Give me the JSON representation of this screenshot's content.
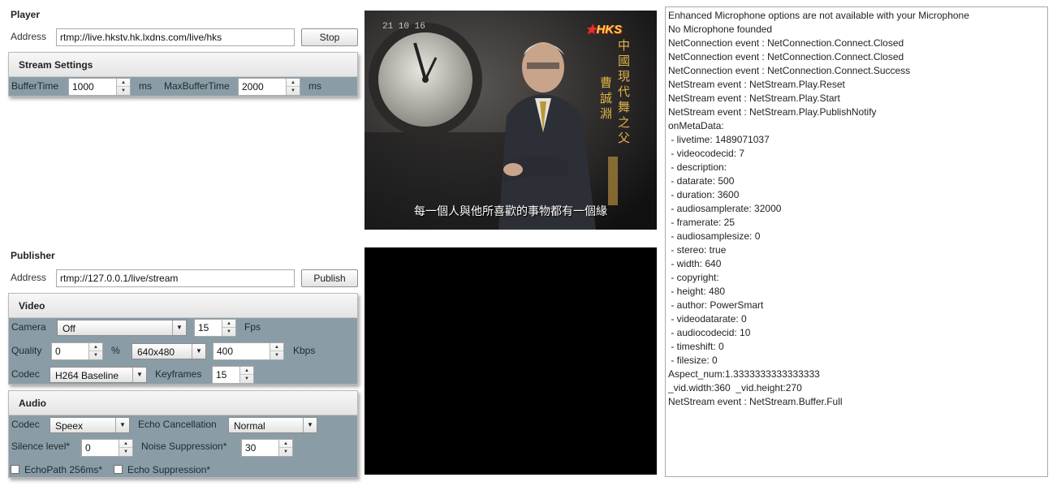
{
  "player": {
    "title": "Player",
    "address_label": "Address",
    "address_value": "rtmp://live.hkstv.hk.lxdns.com/live/hks",
    "stop_label": "Stop",
    "stream_settings": {
      "title": "Stream Settings",
      "buffer_time_label": "BufferTime",
      "buffer_time_value": "1000",
      "buffer_time_unit": "ms",
      "max_buffer_time_label": "MaxBufferTime",
      "max_buffer_time_value": "2000",
      "max_buffer_time_unit": "ms"
    }
  },
  "publisher": {
    "title": "Publisher",
    "address_label": "Address",
    "address_value": "rtmp://127.0.0.1/live/stream",
    "publish_label": "Publish",
    "video": {
      "title": "Video",
      "camera_label": "Camera",
      "camera_value": "Off",
      "fps_value": "15",
      "fps_label": "Fps",
      "quality_label": "Quality",
      "quality_value": "0",
      "quality_unit": "%",
      "resolution_value": "640x480",
      "bitrate_value": "400",
      "bitrate_unit": "Kbps",
      "codec_label": "Codec",
      "codec_value": "H264 Baseline",
      "keyframes_label": "Keyframes",
      "keyframes_value": "15"
    },
    "audio": {
      "title": "Audio",
      "codec_label": "Codec",
      "codec_value": "Speex",
      "echo_cancellation_label": "Echo Cancellation",
      "echo_cancellation_value": "Normal",
      "silence_level_label": "Silence level*",
      "silence_level_value": "0",
      "noise_suppression_label": "Noise Suppression*",
      "noise_suppression_value": "30",
      "echo_path_label": "EchoPath 256ms*",
      "echo_suppression_label": "Echo Suppression*"
    }
  },
  "video_player": {
    "timestamp": "21 10 16",
    "channel_logo": "HKS",
    "vertical_title": "中國現代舞之父",
    "vertical_name": "曹誠淵",
    "subtitle": "每一個人與他所喜歡的事物都有一個緣"
  },
  "log": {
    "lines": [
      "Enhanced Microphone options are not available with your Microphone",
      "No Microphone founded",
      "NetConnection event : NetConnection.Connect.Closed",
      "NetConnection event : NetConnection.Connect.Closed",
      "NetConnection event : NetConnection.Connect.Success",
      "NetStream event : NetStream.Play.Reset",
      "NetStream event : NetStream.Play.Start",
      "NetStream event : NetStream.Play.PublishNotify",
      "onMetaData:",
      " - livetime: 1489071037",
      " - videocodecid: 7",
      " - description:",
      " - datarate: 500",
      " - duration: 3600",
      " - audiosamplerate: 32000",
      " - framerate: 25",
      " - audiosamplesize: 0",
      " - stereo: true",
      " - width: 640",
      " - copyright:",
      " - height: 480",
      " - author: PowerSmart",
      " - videodatarate: 0",
      " - audiocodecid: 10",
      " - timeshift: 0",
      " - filesize: 0",
      "Aspect_num:1.3333333333333333",
      "_vid.width:360  _vid.height:270",
      "NetStream event : NetStream.Buffer.Full"
    ]
  },
  "colors": {
    "panel_body": "#8a9da7",
    "video_background": "#000000",
    "logo_red": "#d32222",
    "caption_gold": "#e0b24a"
  }
}
